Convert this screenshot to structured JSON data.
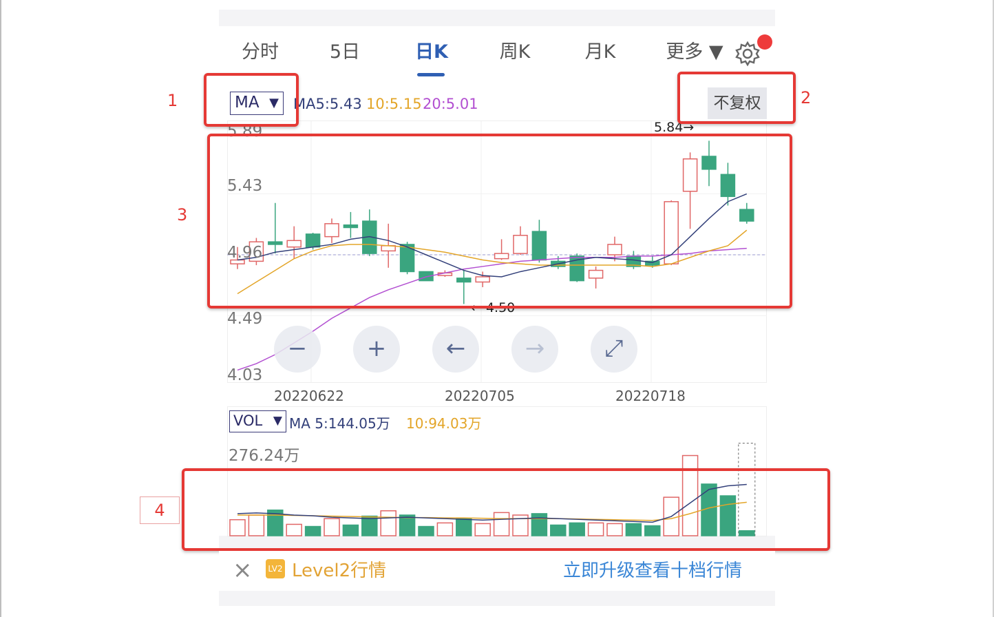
{
  "tabs": [
    {
      "label": "分时",
      "active": false
    },
    {
      "label": "5日",
      "active": false
    },
    {
      "label": "日K",
      "active": true
    },
    {
      "label": "周K",
      "active": false
    },
    {
      "label": "月K",
      "active": false
    },
    {
      "label": "更多 ▼",
      "active": false
    }
  ],
  "indicator": {
    "select_label": "MA",
    "ma5": "MA5:5.43",
    "ma10": "10:5.15",
    "ma20": "20:5.01",
    "adjust_label": "不复权"
  },
  "price_axis": [
    "5.89",
    "5.43",
    "4.96",
    "4.49",
    "4.03"
  ],
  "high_marker": "5.84→",
  "low_marker": "← 4.50",
  "dates": [
    "20220622",
    "20220705",
    "20220718"
  ],
  "controls": [
    {
      "icon": "minus-icon",
      "symbol": "−"
    },
    {
      "icon": "plus-icon",
      "symbol": "+"
    },
    {
      "icon": "arrow-left-icon",
      "symbol": "←"
    },
    {
      "icon": "arrow-right-icon",
      "symbol": "→"
    },
    {
      "icon": "expand-icon",
      "symbol": "⤢"
    }
  ],
  "volume": {
    "select_label": "VOL",
    "ma5": "MA 5:144.05万",
    "ma10": "10:94.03万",
    "max_label": "276.24万"
  },
  "annotations": [
    "1",
    "2",
    "3",
    "4"
  ],
  "bottom": {
    "close": "×",
    "badge": "LV2",
    "level2": "Level2行情",
    "upgrade": "立即升级查看十档行情"
  },
  "colors": {
    "up": "#e06666",
    "down": "#3aa57f",
    "ma5": "#33407a",
    "ma10": "#e3a528",
    "ma20": "#b24fd1",
    "active_tab": "#2f5fb3",
    "annotation": "#e53935"
  },
  "chart_data": {
    "type": "candlestick",
    "ylim": [
      4.03,
      5.89
    ],
    "candles": [
      {
        "o": 4.89,
        "c": 4.92,
        "h": 5.02,
        "l": 4.85
      },
      {
        "o": 4.91,
        "c": 5.06,
        "h": 5.09,
        "l": 4.88
      },
      {
        "o": 5.06,
        "c": 5.04,
        "h": 5.36,
        "l": 4.97
      },
      {
        "o": 5.02,
        "c": 5.07,
        "h": 5.18,
        "l": 4.93
      },
      {
        "o": 5.12,
        "c": 5.02,
        "h": 5.13,
        "l": 5.0
      },
      {
        "o": 5.1,
        "c": 5.2,
        "h": 5.24,
        "l": 5.05
      },
      {
        "o": 5.19,
        "c": 5.17,
        "h": 5.29,
        "l": 5.09
      },
      {
        "o": 5.22,
        "c": 4.97,
        "h": 5.31,
        "l": 4.95
      },
      {
        "o": 4.99,
        "c": 5.03,
        "h": 5.2,
        "l": 4.86
      },
      {
        "o": 5.04,
        "c": 4.83,
        "h": 5.06,
        "l": 4.81
      },
      {
        "o": 4.83,
        "c": 4.76,
        "h": 4.83,
        "l": 4.76
      },
      {
        "o": 4.8,
        "c": 4.82,
        "h": 4.84,
        "l": 4.79
      },
      {
        "o": 4.78,
        "c": 4.75,
        "h": 4.84,
        "l": 4.58
      },
      {
        "o": 4.75,
        "c": 4.79,
        "h": 4.83,
        "l": 4.71
      },
      {
        "o": 4.93,
        "c": 4.97,
        "h": 5.08,
        "l": 4.92
      },
      {
        "o": 4.97,
        "c": 5.11,
        "h": 5.18,
        "l": 4.96
      },
      {
        "o": 5.14,
        "c": 4.92,
        "h": 5.23,
        "l": 4.9
      },
      {
        "o": 4.91,
        "c": 4.87,
        "h": 4.95,
        "l": 4.85
      },
      {
        "o": 4.95,
        "c": 4.76,
        "h": 4.97,
        "l": 4.75
      },
      {
        "o": 4.78,
        "c": 4.84,
        "h": 4.87,
        "l": 4.7
      },
      {
        "o": 4.96,
        "c": 5.04,
        "h": 5.1,
        "l": 4.91
      },
      {
        "o": 4.95,
        "c": 4.87,
        "h": 4.99,
        "l": 4.85
      },
      {
        "o": 4.91,
        "c": 4.88,
        "h": 4.95,
        "l": 4.86
      },
      {
        "o": 4.89,
        "c": 5.37,
        "h": 5.38,
        "l": 4.88
      },
      {
        "o": 5.45,
        "c": 5.7,
        "h": 5.75,
        "l": 5.16
      },
      {
        "o": 5.72,
        "c": 5.62,
        "h": 5.84,
        "l": 5.49
      },
      {
        "o": 5.58,
        "c": 5.41,
        "h": 5.67,
        "l": 5.34
      },
      {
        "o": 5.31,
        "c": 5.22,
        "h": 5.36,
        "l": 5.2
      }
    ],
    "ma5": [
      4.92,
      4.94,
      4.98,
      5.0,
      5.02,
      5.04,
      5.08,
      5.1,
      5.07,
      5.02,
      4.96,
      4.9,
      4.84,
      4.8,
      4.79,
      4.83,
      4.86,
      4.89,
      4.92,
      4.94,
      4.93,
      4.92,
      4.9,
      4.96,
      5.1,
      5.24,
      5.37,
      5.43
    ],
    "ma10": [
      4.66,
      4.75,
      4.84,
      4.93,
      4.99,
      5.03,
      5.04,
      5.04,
      5.03,
      5.02,
      5.0,
      4.98,
      4.95,
      4.92,
      4.9,
      4.89,
      4.88,
      4.88,
      4.88,
      4.88,
      4.88,
      4.88,
      4.87,
      4.89,
      4.94,
      4.99,
      5.03,
      5.15
    ],
    "ma20": [
      4.07,
      4.12,
      4.19,
      4.28,
      4.37,
      4.47,
      4.55,
      4.63,
      4.69,
      4.74,
      4.79,
      4.82,
      4.85,
      4.87,
      4.89,
      4.91,
      4.92,
      4.93,
      4.94,
      4.94,
      4.94,
      4.95,
      4.95,
      4.96,
      4.97,
      4.99,
      5.0,
      5.01
    ],
    "volume": {
      "ylim": [
        0,
        276.24
      ],
      "values": [
        45,
        58,
        72,
        32,
        26,
        48,
        30,
        55,
        70,
        58,
        26,
        36,
        48,
        34,
        65,
        58,
        62,
        30,
        36,
        36,
        34,
        34,
        28,
        108,
        225,
        145,
        112,
        14
      ],
      "up": [
        true,
        true,
        false,
        true,
        false,
        true,
        false,
        false,
        true,
        false,
        false,
        true,
        false,
        true,
        true,
        true,
        false,
        false,
        false,
        true,
        true,
        false,
        false,
        true,
        true,
        false,
        false,
        false
      ],
      "ma5": [
        62,
        64,
        62,
        58,
        56,
        52,
        50,
        48,
        50,
        52,
        50,
        48,
        46,
        44,
        46,
        48,
        50,
        48,
        46,
        44,
        42,
        40,
        38,
        54,
        92,
        130,
        140,
        144
      ],
      "ma10": [
        58,
        58,
        58,
        57,
        56,
        55,
        54,
        53,
        52,
        51,
        51,
        50,
        50,
        49,
        48,
        48,
        48,
        48,
        47,
        46,
        45,
        44,
        43,
        48,
        62,
        78,
        88,
        94
      ]
    }
  }
}
